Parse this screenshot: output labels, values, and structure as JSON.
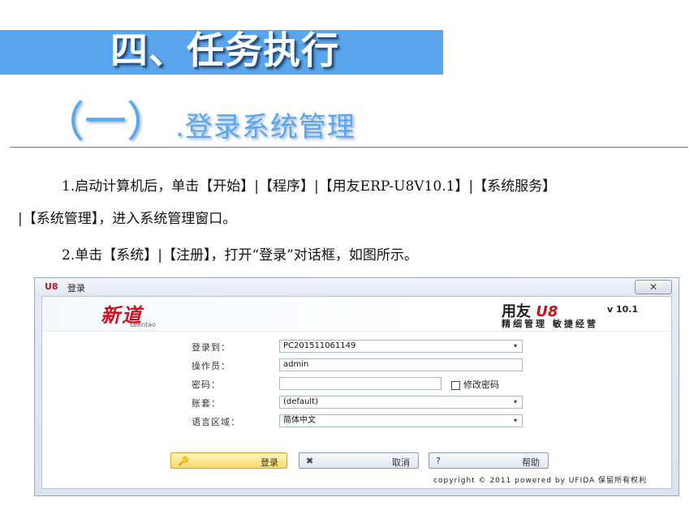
{
  "slide": {
    "main_title": "四、任务执行",
    "sub_paren": "（一）",
    "sub_title": ".登录系统管理",
    "para1_line1": "1.启动计算机后，单击【开始】|【程序】|【用友ERP-U8V10.1】|【系统服务】",
    "para1_line2": "|【系统管理】，进入系统管理窗口。",
    "para2": "2.单击【系统】|【注册】，打开“登录”对话框，如图所示。"
  },
  "dialog": {
    "title": "登录",
    "app_logo_text": "U8",
    "close_symbol": "✕",
    "brand_left": "新道",
    "brand_left_sub": "seentao",
    "brand_right_name": "用友",
    "brand_right_u8": "U8",
    "brand_version": "v 10.1",
    "brand_slogan": "精细管理 敏捷经营",
    "fields": {
      "server_label": "登录到：",
      "server_value": "PC201511061149",
      "operator_label": "操作员：",
      "operator_value": "admin",
      "password_label": "密码：",
      "password_value": "",
      "account_label": "账套：",
      "account_value": "(default)",
      "language_label": "语言区域：",
      "language_value": "简体中文"
    },
    "dropdown_symbol": "▾",
    "change_password_label": "修改密码",
    "buttons": {
      "login": "登录",
      "cancel": "取消",
      "help": "帮助",
      "login_icon": "🔑",
      "cancel_icon": "✖",
      "help_icon": "?"
    },
    "copyright": "copyright © 2011 powered by UFIDA 保留所有权利"
  },
  "colors": {
    "title_band": "#5aa6ee",
    "brand_red": "#c8141e"
  }
}
